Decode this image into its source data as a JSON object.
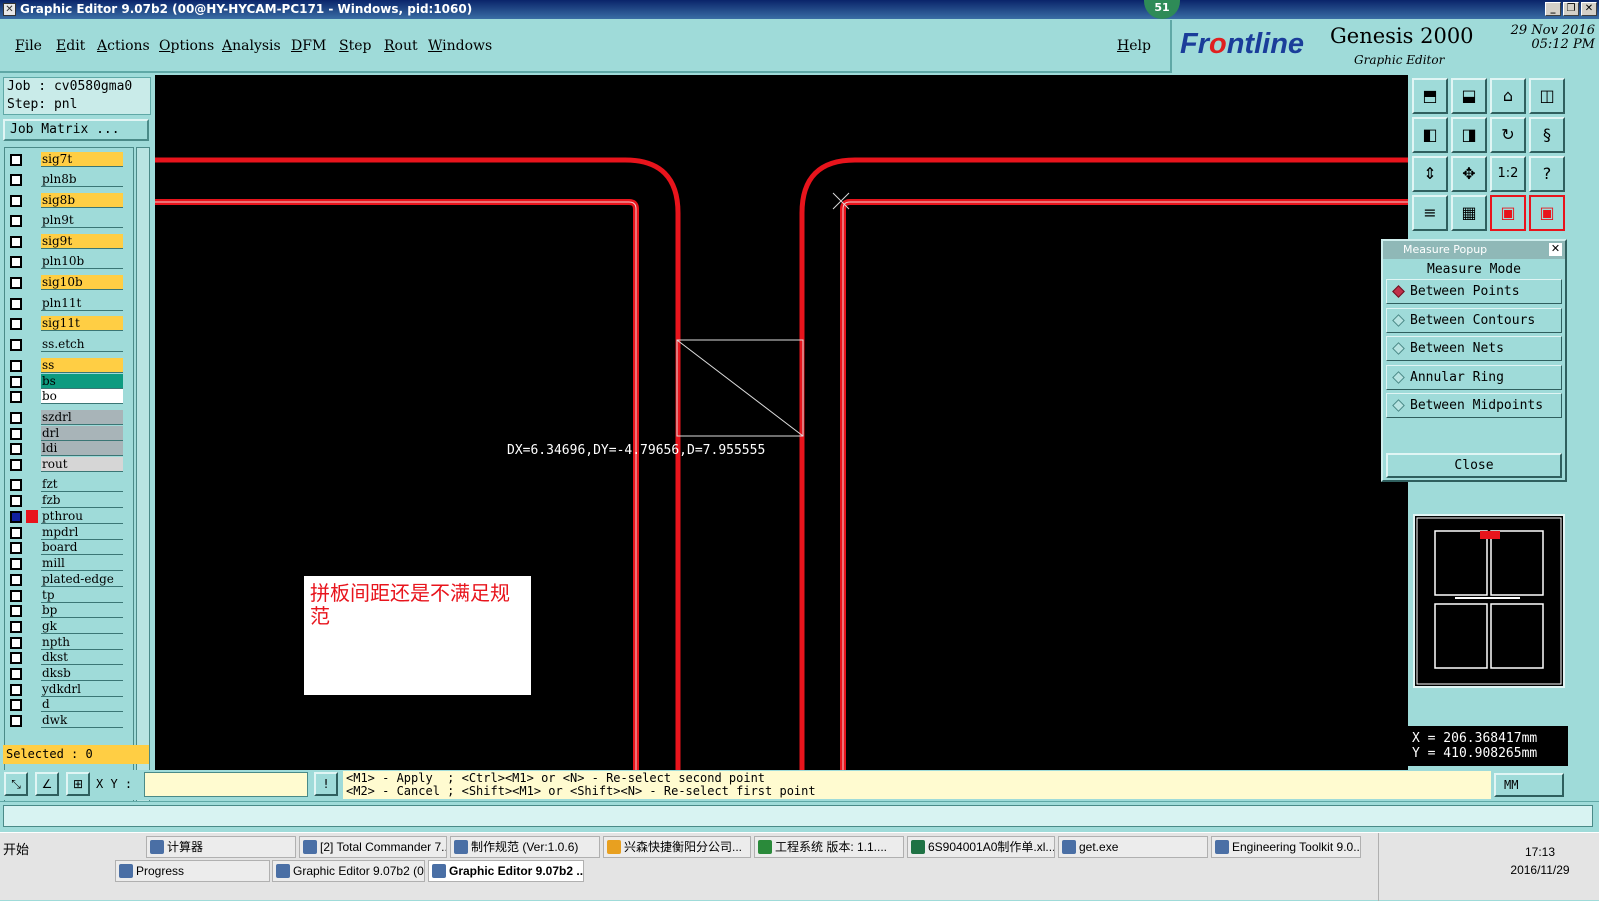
{
  "window": {
    "title": "Graphic Editor 9.07b2 (00@HY-HYCAM-PC171 - Windows, pid:1060)",
    "badge": "51"
  },
  "menu": [
    "File",
    "Edit",
    "Actions",
    "Options",
    "Analysis",
    "DFM",
    "Step",
    "Rout",
    "Windows"
  ],
  "help": "Help",
  "brand": {
    "logo_a": "Fr",
    "logo_b": "o",
    "logo_c": "ntline",
    "product": "Genesis 2000",
    "subtitle": "Graphic Editor",
    "date": "29 Nov 2016",
    "time": "05:12 PM"
  },
  "job": {
    "job_line": "Job : cv0580gma0",
    "step_line": "Step: pnl",
    "matrix_button": "Job Matrix ..."
  },
  "layers": [
    {
      "name": "sig7t",
      "color": "#ffce44"
    },
    {
      "name": "pln8b",
      "color": "#9fdbd9"
    },
    {
      "name": "sig8b",
      "color": "#ffce44"
    },
    {
      "name": "pln9t",
      "color": "#9fdbd9"
    },
    {
      "name": "sig9t",
      "color": "#ffce44"
    },
    {
      "name": "pln10b",
      "color": "#9fdbd9"
    },
    {
      "name": "sig10b",
      "color": "#ffce44"
    },
    {
      "name": "pln11t",
      "color": "#9fdbd9"
    },
    {
      "name": "sig11t",
      "color": "#ffce44"
    },
    {
      "name": "ss.etch",
      "color": "#9fdbd9"
    },
    {
      "name": "ss",
      "color": "#ffce44"
    },
    {
      "name": "bs",
      "color": "#0e9b80"
    },
    {
      "name": "bo",
      "color": "#ffffff"
    },
    {
      "name": "szdrl",
      "color": "#a8b4b8"
    },
    {
      "name": "drl",
      "color": "#a8b4b8"
    },
    {
      "name": "ldi",
      "color": "#a8b4b8"
    },
    {
      "name": "rout",
      "color": "#d6d6d6"
    },
    {
      "name": "fzt",
      "color": "#9fdbd9"
    },
    {
      "name": "fzb",
      "color": "#9fdbd9"
    },
    {
      "name": "pthrou",
      "color": "#9fdbd9"
    },
    {
      "name": "mpdrl",
      "color": "#9fdbd9"
    },
    {
      "name": "board",
      "color": "#9fdbd9"
    },
    {
      "name": "mill",
      "color": "#9fdbd9"
    },
    {
      "name": "plated-edge",
      "color": "#9fdbd9"
    },
    {
      "name": "tp",
      "color": "#9fdbd9"
    },
    {
      "name": "bp",
      "color": "#9fdbd9"
    },
    {
      "name": "gk",
      "color": "#9fdbd9"
    },
    {
      "name": "npth",
      "color": "#9fdbd9"
    },
    {
      "name": "dkst",
      "color": "#9fdbd9"
    },
    {
      "name": "dksb",
      "color": "#9fdbd9"
    },
    {
      "name": "ydkdrl",
      "color": "#9fdbd9"
    },
    {
      "name": "d",
      "color": "#9fdbd9"
    },
    {
      "name": "dwk",
      "color": "#9fdbd9"
    }
  ],
  "selected": "Selected : 0",
  "canvas": {
    "measure_text": "DX=6.34696,DY=-4.79656,D=7.955555",
    "note": "拼板间距还是不满足规范"
  },
  "measure_popup": {
    "title": "Measure Popup",
    "mode_label": "Measure Mode",
    "options": [
      "Between Points",
      "Between Contours",
      "Between Nets",
      "Annular Ring",
      "Between Midpoints"
    ],
    "close": "Close"
  },
  "coords": {
    "x": "X = 206.368417mm",
    "y": "Y = 410.908265mm"
  },
  "bottom": {
    "xy_label": "X Y :",
    "hint_line1": "<M1> - Apply  ; <Ctrl><M1> or <N> - Re-select second point",
    "hint_line2": "<M2> - Cancel ; <Shift><M1> or <Shift><N> - Re-select first point",
    "units": "MM"
  },
  "taskbar": {
    "start": "开始",
    "row1": [
      "计算器",
      "[2] Total Commander 7...",
      "制作规范 (Ver:1.0.6)",
      "兴森快捷衡阳分公司...",
      "工程系统  版本: 1.1....",
      "6S904001A0制作单.xl...",
      "get.exe",
      "Engineering Toolkit 9.0..."
    ],
    "row2": [
      "Progress",
      "Graphic Editor 9.07b2 (0...",
      "Graphic Editor 9.07b2 ..."
    ],
    "clock_time": "17:13",
    "clock_date": "2016/11/29"
  }
}
